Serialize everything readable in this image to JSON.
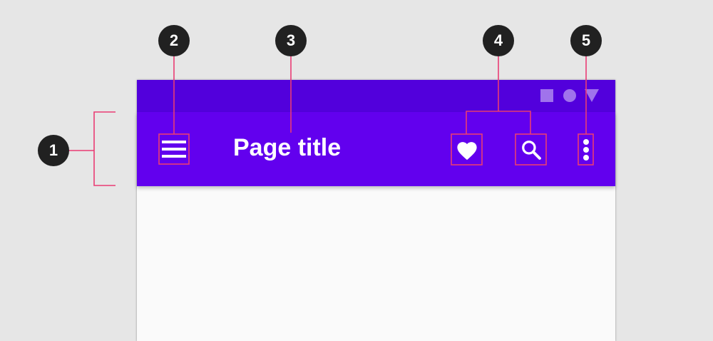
{
  "colors": {
    "background": "#e6e6e6",
    "status_bar": "#5200dc",
    "app_bar": "#6200ee",
    "content": "#fafafa",
    "callout_line": "#ea3c74",
    "badge": "#212121"
  },
  "app_bar": {
    "title": "Page title",
    "navigation_icon": "menu-icon",
    "action_icons": [
      "favorite-icon",
      "search-icon"
    ],
    "overflow_icon": "more-vert-icon"
  },
  "status_bar": {
    "icons": [
      "square-icon",
      "circle-icon",
      "triangle-icon"
    ]
  },
  "callouts": [
    "1",
    "2",
    "3",
    "4",
    "5"
  ]
}
